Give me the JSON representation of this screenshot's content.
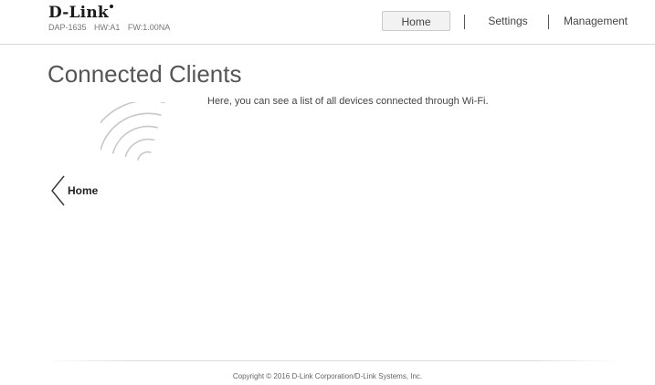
{
  "header": {
    "logo_text": "D-Link",
    "model": "DAP-1635",
    "hardware": "HW:A1",
    "firmware": "FW:1.00NA"
  },
  "nav": {
    "items": [
      {
        "label": "Home",
        "active": true
      },
      {
        "label": "Settings",
        "active": false
      },
      {
        "label": "Management",
        "active": false
      }
    ]
  },
  "main": {
    "title": "Connected Clients",
    "description": "Here, you can see a list of all devices connected through Wi-Fi.",
    "icon": "wifi-icon",
    "back_label": "Home"
  },
  "footer": {
    "copyright": "Copyright © 2016 D-Link Corporation/D-Link Systems, Inc."
  }
}
